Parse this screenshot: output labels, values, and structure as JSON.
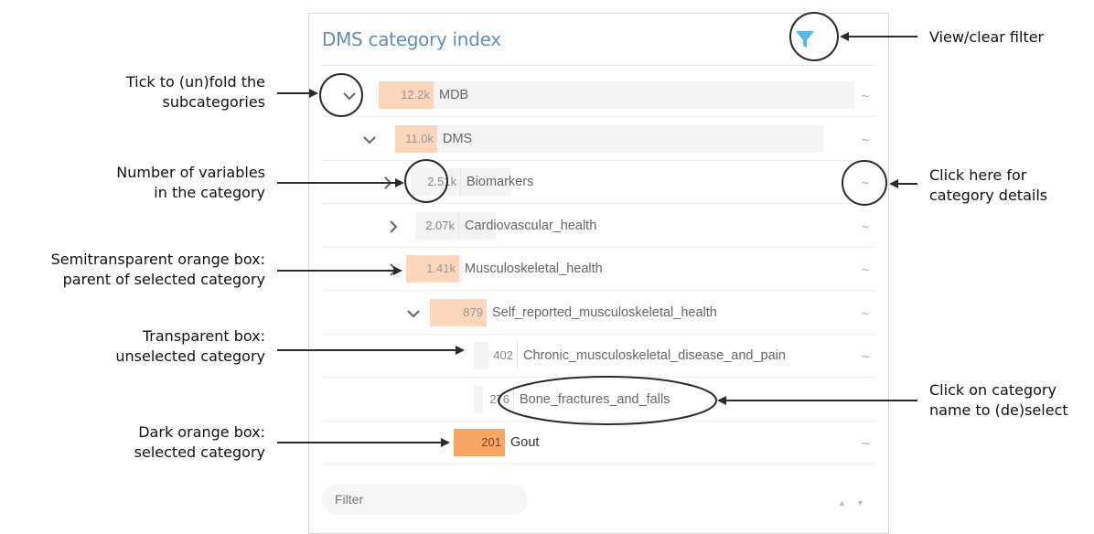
{
  "panel": {
    "title": "DMS category index",
    "filter_icon": "filter-funnel-icon",
    "detail_icon": "tilde-detail-icon",
    "search": {
      "placeholder": "Filter"
    },
    "sort_icons": [
      "triangle-up-icon",
      "triangle-down-icon"
    ],
    "rows": [
      {
        "count": "12.2k",
        "name": "MDB",
        "chevron": "down",
        "box": "semi",
        "fill": 1.0
      },
      {
        "count": "11.0k",
        "name": "DMS",
        "chevron": "down",
        "box": "semi",
        "fill": 0.9
      },
      {
        "count": "2.51k",
        "name": "Biomarkers",
        "chevron": "right",
        "box": "clear",
        "fill": 0.21
      },
      {
        "count": "2.07k",
        "name": "Cardiovascular_health",
        "chevron": "right",
        "box": "clear",
        "fill": 0.17
      },
      {
        "count": "1.41k",
        "name": "Musculoskeletal_health",
        "chevron": "right",
        "box": "semi",
        "fill": 0.12
      },
      {
        "count": "879",
        "name": "Self_reported_musculoskeletal_health",
        "chevron": "down",
        "box": "semi",
        "fill": 0.07
      },
      {
        "count": "402",
        "name": "Chronic_musculoskeletal_disease_and_pain",
        "chevron": "none",
        "box": "clear",
        "fill": 0.03
      },
      {
        "count": "276",
        "name": "Bone_fractures_and_falls",
        "chevron": "none",
        "box": "clear",
        "fill": 0.02
      },
      {
        "count": "201",
        "name": "Gout",
        "chevron": "none",
        "box": "sel",
        "fill": 0.02
      }
    ]
  },
  "annotations": {
    "fold": [
      "Tick to (un)fold the",
      "subcategories"
    ],
    "count": [
      "Number of variables",
      "in the category"
    ],
    "semi": [
      "Semitransparent orange box:",
      "parent of selected category"
    ],
    "transparent": [
      "Transparent box:",
      "unselected category"
    ],
    "dark": [
      "Dark orange box:",
      "selected category"
    ],
    "filter": [
      "View/clear filter"
    ],
    "details": [
      "Click here for",
      "category details"
    ],
    "select": [
      "Click on category",
      "name to (de)select"
    ]
  },
  "colors": {
    "title": "#5f8fb6",
    "semi_box": "#fbd6bb",
    "selected_box": "#f7a665",
    "filter_icon": "#5bb6e8",
    "annotation": "#2b2b2b"
  }
}
